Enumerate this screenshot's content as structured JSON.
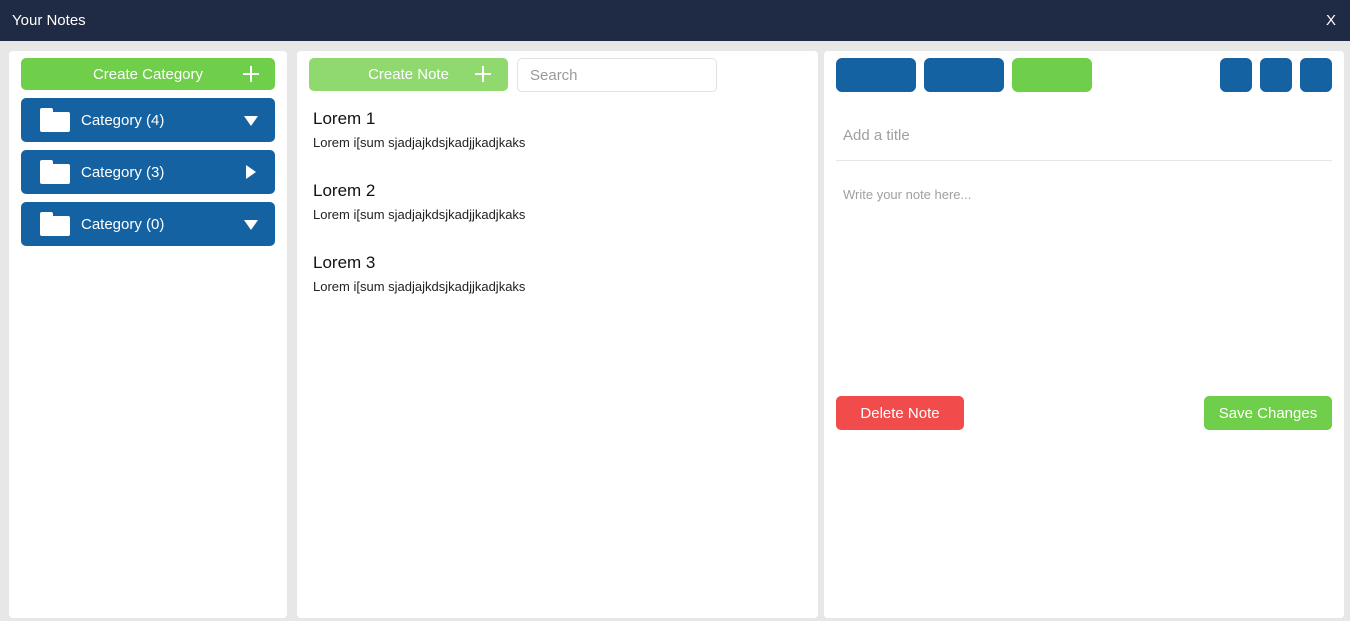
{
  "window": {
    "title": "Your Notes",
    "close_label": "X"
  },
  "categories_panel": {
    "create_label": "Create Category",
    "items": [
      {
        "label": "Category (4)",
        "expanded": true
      },
      {
        "label": "Category (3)",
        "expanded": false
      },
      {
        "label": "Category (0)",
        "expanded": true
      }
    ]
  },
  "notes_panel": {
    "create_label": "Create Note",
    "search_placeholder": "Search",
    "notes": [
      {
        "title": "Lorem 1",
        "preview": "Lorem i[sum sjadjajkdsjkadjjkadjkaks"
      },
      {
        "title": "Lorem 2",
        "preview": "Lorem i[sum sjadjajkdsjkadjjkadjkaks"
      },
      {
        "title": "Lorem 3",
        "preview": "Lorem i[sum sjadjajkdsjkadjjkadjkaks"
      }
    ]
  },
  "editor": {
    "title_placeholder": "Add a title",
    "body_placeholder": "Write your note here...",
    "delete_label": "Delete Note",
    "save_label": "Save Changes"
  },
  "colors": {
    "titlebar": "#1f2a44",
    "primary_blue": "#1462a1",
    "green": "#6fcf4a",
    "light_green": "#8fd96f",
    "red": "#f14b4b"
  }
}
